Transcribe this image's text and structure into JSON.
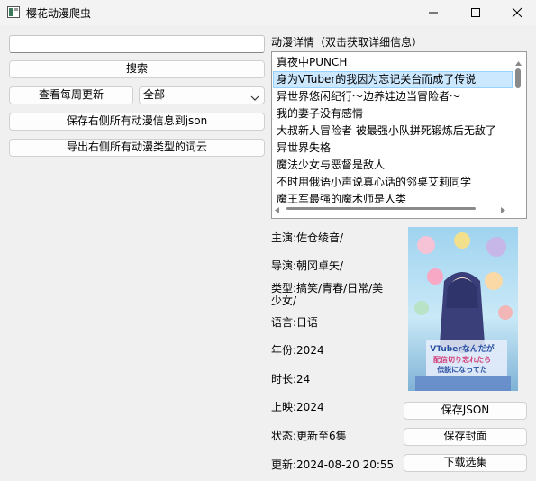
{
  "window": {
    "title": "樱花动漫爬虫"
  },
  "left": {
    "search_value": "",
    "search_button": "搜索",
    "weekly_button": "查看每周更新",
    "filter_select": "全部",
    "save_json_button": "保存右侧所有动漫信息到json",
    "export_wordcloud_button": "导出右侧所有动漫类型的词云"
  },
  "details": {
    "heading": "动漫详情（双击获取详细信息）",
    "list": [
      "真夜中PUNCH",
      "身为VTuber的我因为忘记关台而成了传说",
      "异世界悠闲纪行～边养娃边当冒险者～",
      "我的妻子没有感情",
      "大叔新人冒险者 被最强小队拼死锻炼后无敌了",
      "异世界失格",
      "魔法少女与恶督是敌人",
      "不时用俄语小声说真心话的邻桌艾莉同学",
      "魔王军最强的魔术师是人类"
    ],
    "selected_index": 1
  },
  "info": {
    "cast": "主演:佐仓绫音/",
    "director": "导演:朝冈卓矢/",
    "genre_line1": "类型:搞笑/青春/日常/美",
    "genre_line2": "少女/",
    "language": "语言:日语",
    "year": "年份:2024",
    "duration": "时长:24",
    "release": "上映:2024",
    "status": "状态:更新至6集",
    "updated": "更新:2024-08-20 20:55"
  },
  "actions": {
    "save_json": "保存JSON",
    "save_cover": "保存封面",
    "download_episodes": "下载选集"
  },
  "cover": {
    "logo_lines": [
      "VTuberなんだが",
      "配信切り忘れたら",
      "伝説になってた"
    ]
  },
  "colors": {
    "selection": "#cce8ff",
    "selection_border": "#99d1ff",
    "window_bg": "#f0f0f0"
  }
}
